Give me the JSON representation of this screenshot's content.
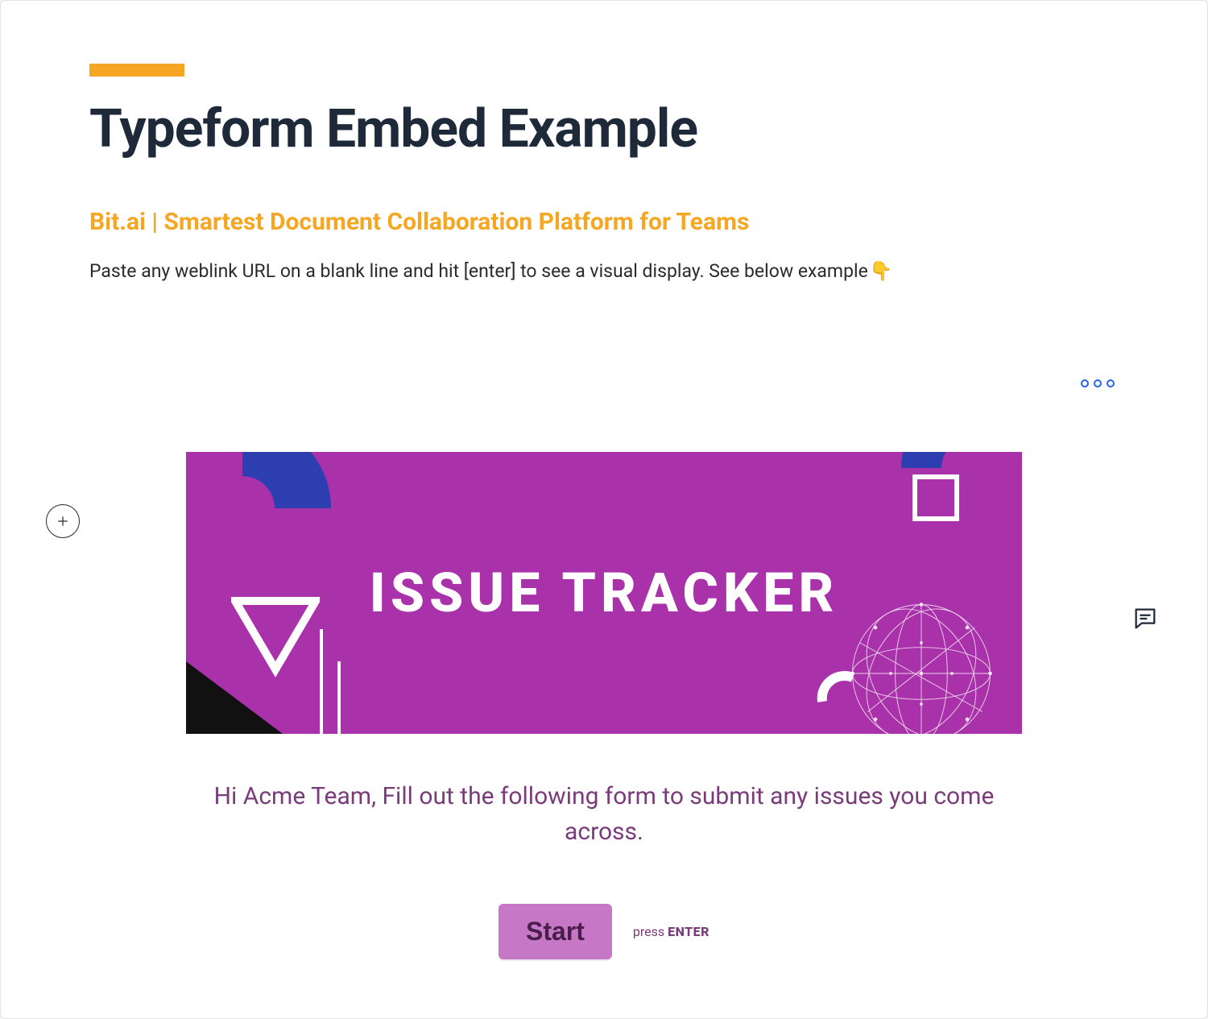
{
  "colors": {
    "accent": "#f5a623",
    "title": "#1e2a3a",
    "banner_bg": "#a931a9",
    "form_text": "#7a3b7a",
    "start_button_bg": "#c678c6",
    "options_ring": "#2563eb"
  },
  "header": {
    "title": "Typeform Embed Example",
    "subtitle": "Bit.ai | Smartest Document Collaboration Platform for Teams",
    "instruction": "Paste any weblink URL on a blank line and hit [enter] to see a visual display. See below example",
    "pointer_emoji": "👇"
  },
  "icons": {
    "add": "plus-icon",
    "options": "ellipsis-icon",
    "comment": "chat-icon"
  },
  "embed": {
    "banner_title": "ISSUE TRACKER",
    "intro": "Hi Acme Team, Fill out the following form to submit any issues you come across.",
    "start_label": "Start",
    "press_prefix": "press ",
    "press_key": "ENTER"
  }
}
